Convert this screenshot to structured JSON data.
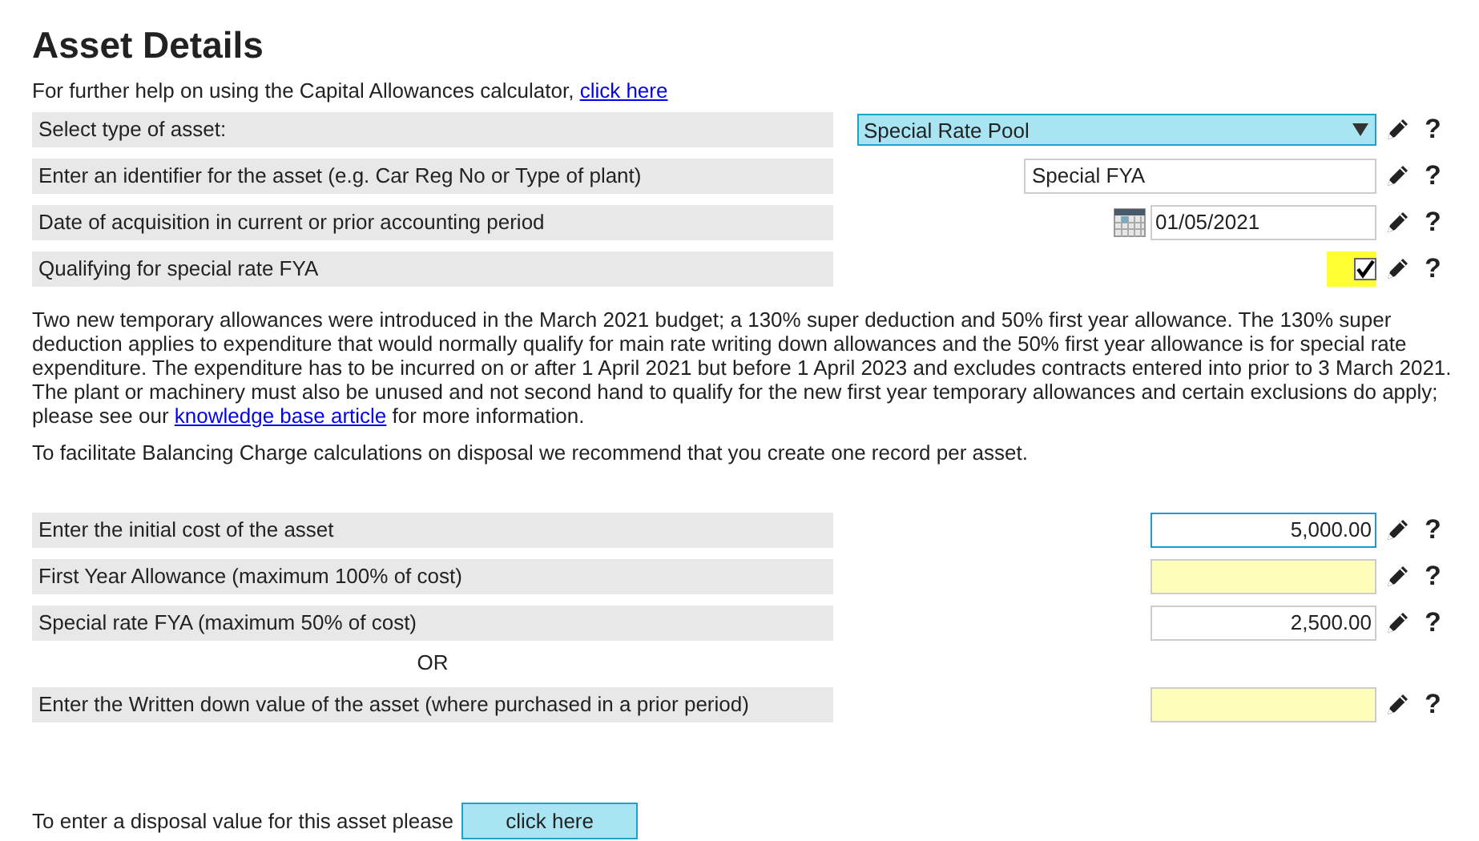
{
  "title": "Asset Details",
  "help_line": {
    "text": "For further help on using the Capital Allowances calculator,",
    "link": "click here"
  },
  "asset_rows": [
    {
      "label": "Select type of asset:",
      "kind": "select",
      "value": "Special Rate Pool",
      "help": "?"
    },
    {
      "label": "Enter an identifier for the asset (e.g. Car Reg No or Type of plant)",
      "kind": "text",
      "value": "Special FYA",
      "help": "?"
    },
    {
      "label": "Date of acquisition in current or prior accounting period",
      "kind": "date",
      "value": "01/05/2021",
      "help": "?"
    },
    {
      "label": "Qualifying for special rate FYA",
      "kind": "checkbox",
      "checked": true,
      "highlighted": true,
      "help": "?"
    }
  ],
  "info_paragraph": {
    "text": "Two new temporary allowances were introduced in the March 2021 budget; a 130% super deduction and 50% first year allowance. The 130% super deduction applies to expenditure that would normally qualify for main rate writing down allowances and the 50% first year allowance is for special rate expenditure. The expenditure has to be incurred on or after 1 April 2021 but before 1 April 2023 and excludes contracts entered into prior to 3 March 2021. The plant or machinery must also be unused and not second hand to qualify for the new first year temporary allowances and certain exclusions do apply; please see our",
    "link": "knowledge base article",
    "after": "for more information."
  },
  "recommendation": "To facilitate Balancing Charge calculations on disposal we recommend that you create one record per asset.",
  "cost_rows": [
    {
      "kind": "field",
      "label": "Enter the initial cost of the asset",
      "value": "5,000.00",
      "color": "#ffffff",
      "focused": true,
      "help": "?"
    },
    {
      "kind": "field",
      "label": "First Year Allowance (maximum 100% of cost)",
      "color": "#ffffbb",
      "focused": false,
      "help": "?"
    },
    {
      "kind": "field",
      "label": "Special rate FYA (maximum 50% of cost)",
      "value": "2,500.00",
      "color": "#ffffff",
      "focused": false,
      "help": "?"
    },
    {
      "kind": "separator",
      "text": "OR"
    },
    {
      "kind": "field",
      "label": "Enter the Written down value of the asset (where purchased in a prior period)",
      "color": "#ffffbb",
      "focused": false,
      "help": "?"
    }
  ],
  "disposal": {
    "text": "To enter a disposal value for this asset please",
    "button": "click here"
  }
}
